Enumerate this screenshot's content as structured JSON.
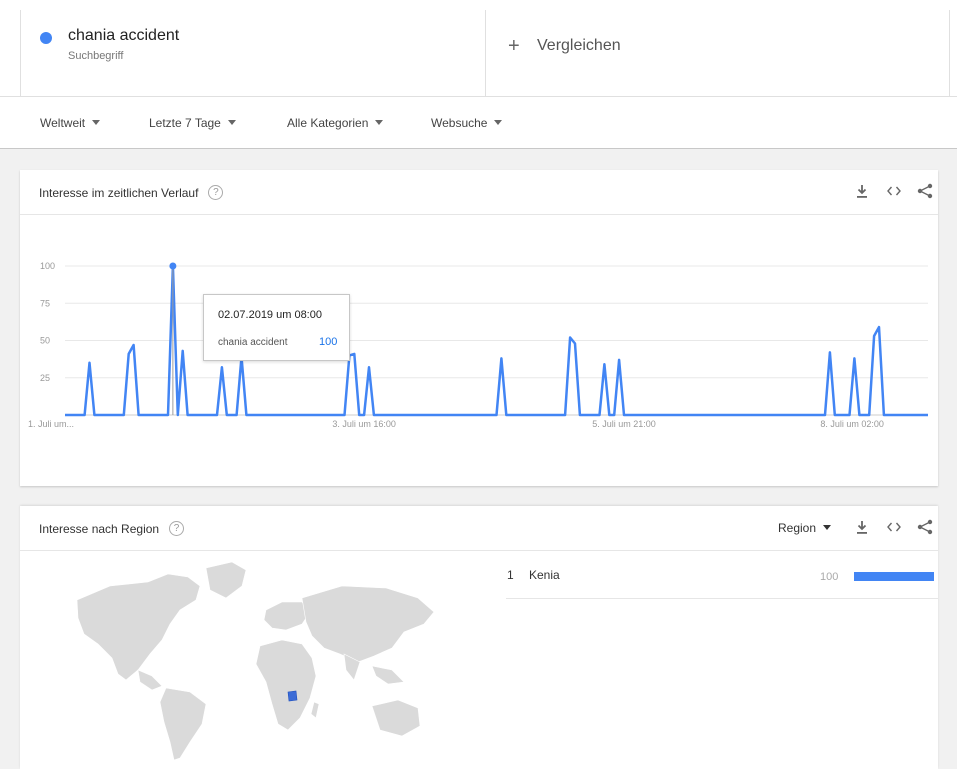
{
  "search": {
    "term": "chania accident",
    "term_type": "Suchbegriff",
    "term_color": "#4285f4",
    "compare_label": "Vergleichen"
  },
  "filters": [
    "Weltweit",
    "Letzte 7 Tage",
    "Alle Kategorien",
    "Websuche"
  ],
  "time_card": {
    "title": "Interesse im zeitlichen Verlauf",
    "icons": [
      "download-icon",
      "embed-icon",
      "share-icon"
    ],
    "tooltip": {
      "date": "02.07.2019 um 08:00",
      "term": "chania accident",
      "value": "100"
    }
  },
  "chart_data": {
    "type": "line",
    "title": "",
    "xlabel": "",
    "ylabel": "",
    "ylim": [
      0,
      100
    ],
    "yticks": [
      25,
      50,
      75,
      100
    ],
    "grid": true,
    "x_tick_labels": [
      {
        "label": "1. Juli um...",
        "index": 0
      },
      {
        "label": "3. Juli um 16:00",
        "index": 61
      },
      {
        "label": "5. Juli um 21:00",
        "index": 114
      },
      {
        "label": "8. Juli um 02:00",
        "index": 167
      }
    ],
    "series": [
      {
        "color": "#4285f4",
        "values": [
          0,
          0,
          0,
          0,
          0,
          35,
          0,
          0,
          0,
          0,
          0,
          0,
          0,
          41,
          47,
          0,
          0,
          0,
          0,
          0,
          0,
          0,
          100,
          0,
          43,
          0,
          0,
          0,
          0,
          0,
          0,
          0,
          32,
          0,
          0,
          0,
          39,
          0,
          0,
          0,
          0,
          0,
          0,
          0,
          0,
          0,
          0,
          0,
          0,
          0,
          0,
          0,
          0,
          0,
          0,
          0,
          0,
          0,
          40,
          41,
          0,
          0,
          32,
          0,
          0,
          0,
          0,
          0,
          0,
          0,
          0,
          0,
          0,
          0,
          0,
          0,
          0,
          0,
          0,
          0,
          0,
          0,
          0,
          0,
          0,
          0,
          0,
          0,
          0,
          38,
          0,
          0,
          0,
          0,
          0,
          0,
          0,
          0,
          0,
          0,
          0,
          0,
          0,
          52,
          48,
          0,
          0,
          0,
          0,
          0,
          34,
          0,
          0,
          37,
          0,
          0,
          0,
          0,
          0,
          0,
          0,
          0,
          0,
          0,
          0,
          0,
          0,
          0,
          0,
          0,
          0,
          0,
          0,
          0,
          0,
          0,
          0,
          0,
          0,
          0,
          0,
          0,
          0,
          0,
          0,
          0,
          0,
          0,
          0,
          0,
          0,
          0,
          0,
          0,
          0,
          0,
          42,
          0,
          0,
          0,
          0,
          38,
          0,
          0,
          0,
          53,
          59,
          0,
          0,
          0,
          0,
          0,
          0,
          0,
          0,
          0,
          0
        ]
      }
    ]
  },
  "region_card": {
    "title": "Interesse nach Region",
    "region_select": "Region",
    "icons": [
      "download-icon",
      "embed-icon",
      "share-icon"
    ],
    "rows": [
      {
        "rank": "1",
        "name": "Kenia",
        "value": "100",
        "fraction": 1.0
      }
    ],
    "highlight_color": "#4285f4"
  }
}
